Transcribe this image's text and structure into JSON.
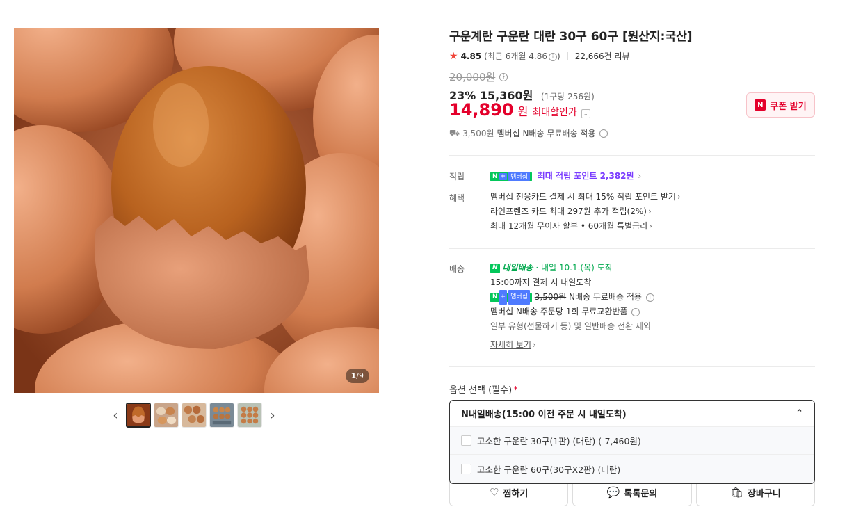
{
  "gallery": {
    "counter_current": "1",
    "counter_total": "/9",
    "prev_arrow": "‹",
    "next_arrow": "›",
    "thumbnails": [
      "thumb-1",
      "thumb-2",
      "thumb-3",
      "thumb-4",
      "thumb-5"
    ]
  },
  "product": {
    "title": "구운계란 구운란 대란 30구 60구 [원산지:국산]",
    "rating": "4.85",
    "recent_rating": "(최근 6개월 4.86",
    "recent_rating_close": ")",
    "review_count": "22,666건 리뷰",
    "original_price": "20,000원",
    "discount_rate": "23%",
    "sale_price": "15,360원",
    "unit_price": "(1구당 256원)",
    "max_discount_price": "14,890",
    "max_discount_won": "원",
    "max_discount_label": "최대할인가",
    "coupon_button": "쿠폰 받기",
    "coupon_badge": "N",
    "shipping_fee_struck": "3,500원",
    "shipping_text": "멤버십 N배송 무료배송 적용"
  },
  "benefits": {
    "points_label": "적립",
    "points_badge_n": "N",
    "points_badge_plus": "+",
    "points_badge_text": "멤버십",
    "points_text": "최대 적립 포인트 2,382원",
    "benefit_label": "혜택",
    "benefit_items": [
      "멤버십 전용카드 결제 시 최대 15% 적립 포인트 받기",
      "라인프렌즈 카드 최대 297원 추가 적립(2%)",
      "최대 12개월 무이자 할부 • 60개월 특별금리"
    ]
  },
  "delivery": {
    "label": "배송",
    "tomorrow_badge": "내일배송",
    "arrival": "· 내일 10.1.(목) 도착",
    "cutoff": "15:00까지 결제 시 내일도착",
    "fee_struck": "3,500원",
    "fee_text": "N배송 무료배송 적용",
    "exchange": "멤버십 N배송 주문당 1회 무료교환반품",
    "exception": "일부 유형(선물하기 등) 및 일반배송 전환 제외",
    "details_link": "자세히 보기"
  },
  "options": {
    "label": "옵션 선택 (필수)",
    "required_mark": "*",
    "selected": "N내일배송(15:00 이전 주문 시 내일도착)",
    "items": [
      "고소한 구운란 30구(1판) (대란) (-7,460원)",
      "고소한 구운란 60구(30구X2판) (대란)"
    ]
  },
  "actions": {
    "wish": "찜하기",
    "talk": "톡톡문의",
    "cart": "장바구니"
  },
  "colors": {
    "accent_red": "#e4002b",
    "naver_green": "#03c75a",
    "point_purple": "#7a3cff"
  }
}
